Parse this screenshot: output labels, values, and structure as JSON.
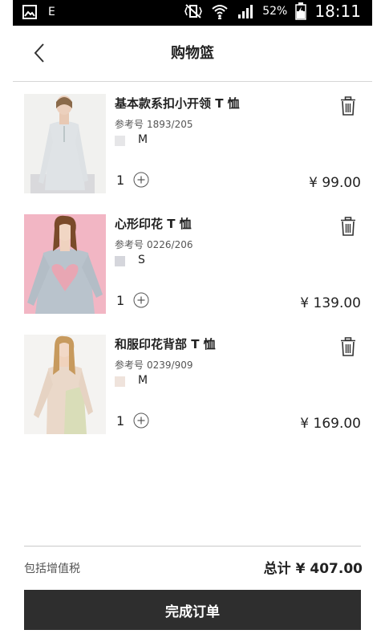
{
  "status_bar": {
    "icons": [
      "gallery-icon",
      "e-icon",
      "vibrate-mute-icon",
      "wifi-icon",
      "signal-icon",
      "battery-charging-icon"
    ],
    "e_label": "E",
    "battery": "52%",
    "time": "18:11"
  },
  "header": {
    "title": "购物篮",
    "back_icon": "chevron-left-icon"
  },
  "items": [
    {
      "name": "基本款系扣小开领 T 恤",
      "ref_label": "参考号",
      "ref": "1893/205",
      "swatch_color": "#e6e6e8",
      "size": "M",
      "quantity": "1",
      "price": "¥ 99.00",
      "image": "model-grey-henley-shirt"
    },
    {
      "name": "心形印花 T 恤",
      "ref_label": "参考号",
      "ref": "0226/206",
      "swatch_color": "#d5d6dc",
      "size": "S",
      "quantity": "1",
      "price": "¥ 139.00",
      "image": "model-heart-print-tee-pink-background"
    },
    {
      "name": "和服印花背部 T 恤",
      "ref_label": "参考号",
      "ref": "0239/909",
      "swatch_color": "#efe3dc",
      "size": "M",
      "quantity": "1",
      "price": "¥ 169.00",
      "image": "model-kimono-print-tee"
    }
  ],
  "footer": {
    "tax_note": "包括增值税",
    "total_label": "总计",
    "total_value": "¥ 407.00",
    "checkout_label": "完成订单"
  },
  "colors": {
    "checkout_bg": "#2e2e2e",
    "status_bar_bg": "#000000",
    "divider": "#d6d6d6"
  }
}
